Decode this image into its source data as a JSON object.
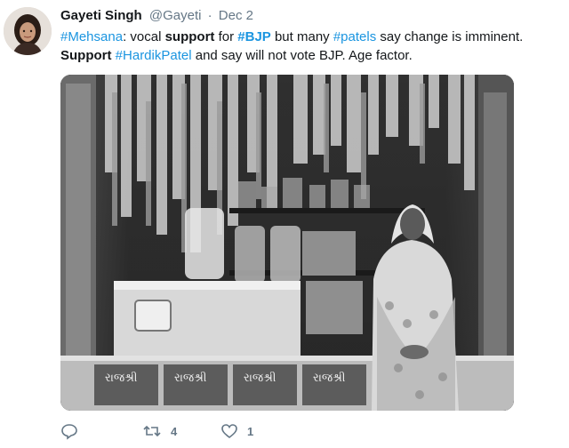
{
  "tweet": {
    "author_name": "Gayeti Singh",
    "author_handle": "@Gayeti",
    "separator": "·",
    "date": "Dec 2",
    "text": {
      "line1": [
        {
          "text": "#Mehsana",
          "style": "hashtag"
        },
        {
          "text": ": vocal ",
          "style": "plain"
        },
        {
          "text": "support",
          "style": "strong"
        },
        {
          "text": " for ",
          "style": "plain"
        },
        {
          "text": "#BJP",
          "style": "hashtag-strong"
        },
        {
          "text": " but many ",
          "style": "plain"
        },
        {
          "text": "#patels",
          "style": "hashtag"
        },
        {
          "text": " say change is imminent.",
          "style": "plain"
        }
      ],
      "line2": [
        {
          "text": "Support",
          "style": "strong"
        },
        {
          "text": " ",
          "style": "plain"
        },
        {
          "text": "#HardikPatel",
          "style": "hashtag"
        },
        {
          "text": " and say will not vote BJP. Age factor.",
          "style": "plain"
        }
      ]
    },
    "photo": {
      "signs": [
        "રાજશ્રી",
        "રાજશ્રી",
        "રાજશ્રી",
        "રાજશ્રી"
      ]
    },
    "actions": {
      "reply_icon": "reply-icon",
      "retweet_icon": "retweet-icon",
      "retweet_count": "4",
      "like_icon": "heart-icon",
      "like_count": "1"
    }
  },
  "colors": {
    "hashtag": "#1b95e0",
    "muted": "#657786",
    "text": "#14171a"
  }
}
